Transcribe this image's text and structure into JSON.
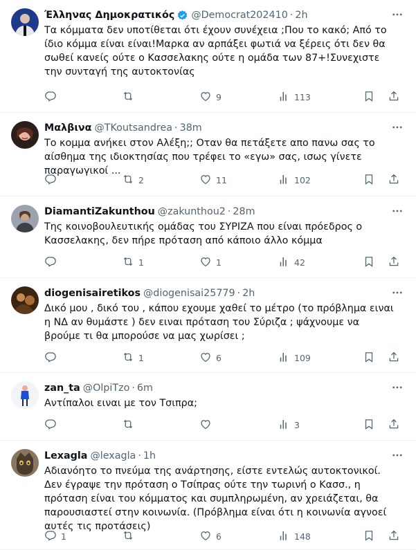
{
  "tweets": [
    {
      "name": "Έλληνας Δημοκρατικός",
      "verified": true,
      "handle": "@Democrat202410",
      "time": "2h",
      "text": "Τα κόμματα δεν υποτίθεται ότι έχουν συνέχεια ;Που το κακό; Από το ίδιο κόμμα είναι είναι!Μαρκα αν αρπάξει φωτιά να ξέρεις ότι δεν θα σωθεί κανείς ούτε ο Κασσελακης ούτε η ομάδα των 87+!Συνεχιστε την συνταγή της αυτοκτονίας",
      "replies": "",
      "retweets": "",
      "likes": "9",
      "views": "113"
    },
    {
      "name": "Μαλβινα",
      "verified": false,
      "handle": "@TKoutsandrea",
      "time": "38m",
      "text": "Το κομμα ανήκει στον Αλέξη;; Οταν θα πετάξετε απο πανω σας το αίσθημα της ιδιοκτησίας που τρέφει το «εγω» σας, ισως γίνετε παραγωγικοί ...",
      "replies": "",
      "retweets": "2",
      "likes": "11",
      "views": "102"
    },
    {
      "name": "DiamantiZakunthou",
      "verified": false,
      "handle": "@zakunthou2",
      "time": "28m",
      "text": "Της κοινοβουλευτικής ομάδας του ΣΥΡΙΖΑ που είναι πρόεδρος ο Κασσελακης, δεν πήρε πρόταση από κάποιο άλλο κόμμα",
      "replies": "",
      "retweets": "1",
      "likes": "1",
      "views": "42"
    },
    {
      "name": "diogenisairetikos",
      "verified": false,
      "handle": "@diogenisai25779",
      "time": "2h",
      "text": "Δικό μου , δικό του , κάπου εχουμε χαθεί το μέτρο (το πρόβλημα ειναι η ΝΔ αν θυμάστε ) δεν ειναι πρόταση του Σύριζα ; ψάχνουμε να βρούμε τι θα μπορούσε να μας χωρίσει ;",
      "replies": "",
      "retweets": "1",
      "likes": "6",
      "views": "109"
    },
    {
      "name": "zan_ta",
      "verified": false,
      "handle": "@OlpiTzo",
      "time": "6m",
      "text": "Αντίπαλοι ειναι με τον Τσιπρα;",
      "replies": "",
      "retweets": "",
      "likes": "",
      "views": "3"
    },
    {
      "name": "Lexagla",
      "verified": false,
      "handle": "@lexagla",
      "time": "1h",
      "text": "Αδιανόητο το πνεύμα της ανάρτησης, είστε εντελώς αυτοκτονικοί. Δεν έγραψε την πρόταση ο Τσίπρας ούτε την τωρινή ο Κασσ., η πρόταση είναι του κόμματος και συμπληρωμένη, αν χρειάζεται, θα παρουσιαστεί στην κοινωνία. (Πρόβλημα είναι ότι η κοινωνία αγνοεί αυτές τις προτάσεις)",
      "replies": "1",
      "retweets": "",
      "likes": "6",
      "views": "148"
    }
  ],
  "dot_separator": "·",
  "colors": {
    "text": "#0f1419",
    "secondary": "#536471",
    "verified": "#1d9bf0",
    "divider": "#eff3f4"
  }
}
